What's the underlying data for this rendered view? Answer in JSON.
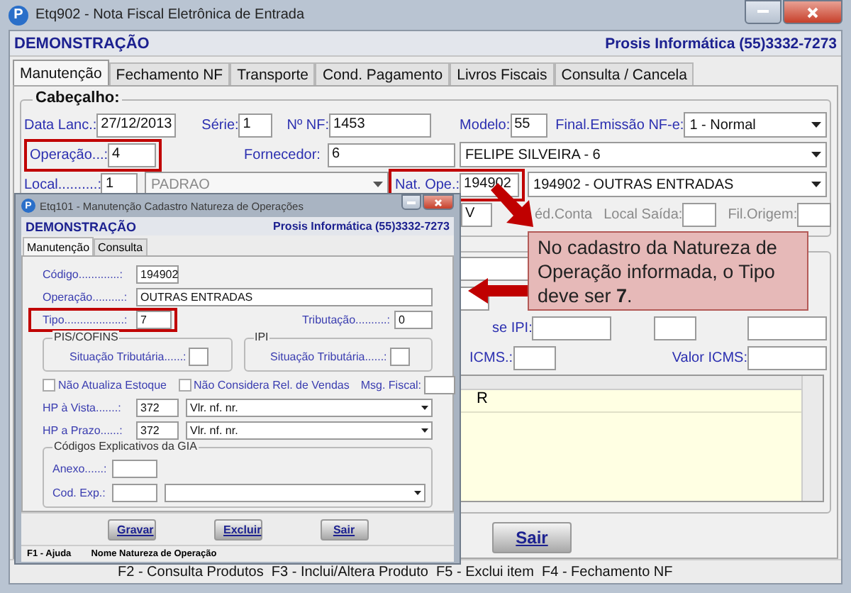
{
  "window": {
    "logo": "P",
    "title": "Etq902 - Nota Fiscal Eletrônica de Entrada",
    "company": "DEMONSTRAÇÃO",
    "contact": "Prosis Informática (55)3332-7273"
  },
  "tabs": [
    {
      "label": "Manutenção",
      "selected": true
    },
    {
      "label": "Fechamento NF",
      "selected": false
    },
    {
      "label": "Transporte",
      "selected": false
    },
    {
      "label": "Cond. Pagamento",
      "selected": false
    },
    {
      "label": "Livros Fiscais",
      "selected": false
    },
    {
      "label": "Consulta / Cancela",
      "selected": false
    }
  ],
  "header_group": {
    "title": "Cabeçalho:",
    "data_lanc": {
      "label": "Data Lanc.:",
      "value": "27/12/2013"
    },
    "serie": {
      "label": "Série:",
      "value": "1"
    },
    "nf": {
      "label": "Nº NF:",
      "value": "1453"
    },
    "modelo": {
      "label": "Modelo:",
      "value": "55"
    },
    "final_emissao": {
      "label": "Final.Emissão NF-e:",
      "value": "1 - Normal"
    },
    "operacao": {
      "label": "Operação...:",
      "value": "4",
      "highlighted": true
    },
    "fornecedor": {
      "label": "Fornecedor:",
      "value": "6",
      "name": "FELIPE SILVEIRA - 6"
    },
    "local": {
      "label": "Local..........:",
      "value": "1",
      "name": "PADRAO",
      "disabled": true
    },
    "nat_ope": {
      "label": "Nat. Ope.:",
      "value": "194902",
      "name": "194902 - OUTRAS ENTRADAS",
      "highlighted": true
    },
    "field_v": "V",
    "cred_conta": "éd.Conta",
    "local_saida": "Local Saída:",
    "fil_origem": "Fil.Origem:"
  },
  "totals_group": {
    "base_ipi": "se IPI:",
    "icms": "ICMS.:",
    "valor_icms": "Valor ICMS:"
  },
  "items_grid": {
    "rows": [
      "R"
    ]
  },
  "sair_button": "Sair",
  "status_bar": "F2 - Consulta Produtos  F3 - Inclui/Altera Produto  F5 - Exclui item  F4 - Fechamento NF",
  "dialog": {
    "logo": "P",
    "title": "Etq101 - Manutenção Cadastro Natureza de Operações",
    "company": "DEMONSTRAÇÃO",
    "contact": "Prosis Informática (55)3332-7273",
    "tabs": [
      {
        "label": "Manutenção",
        "selected": true
      },
      {
        "label": "Consulta",
        "selected": false
      }
    ],
    "codigo": {
      "label": "Código.............:",
      "value": "194902"
    },
    "operacao": {
      "label": "Operação..........:",
      "value": "OUTRAS ENTRADAS"
    },
    "tipo": {
      "label": "Tipo...................:",
      "value": "7",
      "highlighted": true
    },
    "tributacao": {
      "label": "Tributação..........:",
      "value": "0"
    },
    "groups": [
      {
        "title": "PIS/COFINS",
        "label": "Situação Tributária......:"
      },
      {
        "title": "IPI",
        "label": "Situação Tributária......:"
      }
    ],
    "checkboxes": [
      {
        "label": "Não Atualiza Estoque",
        "checked": false
      },
      {
        "label": "Não Considera Rel. de Vendas",
        "checked": false
      }
    ],
    "msg_fiscal": "Msg. Fiscal:",
    "hp": [
      {
        "label": "HP à Vista.......:",
        "value": "372",
        "option": "Vlr. nf. nr."
      },
      {
        "label": "HP a Prazo......:",
        "value": "372",
        "option": "Vlr. nf. nr."
      }
    ],
    "gia": {
      "title": "Códigos Explicativos da GIA",
      "anexo": "Anexo......:",
      "cod_exp": "Cod. Exp.:"
    },
    "buttons": [
      "Gravar",
      "Excluir",
      "Sair"
    ],
    "status": [
      "F1 - Ajuda",
      "Nome Natureza de Operação"
    ]
  },
  "callout": {
    "text": "No cadastro da Natureza de Operação informada, o Tipo deve ser **7**."
  }
}
